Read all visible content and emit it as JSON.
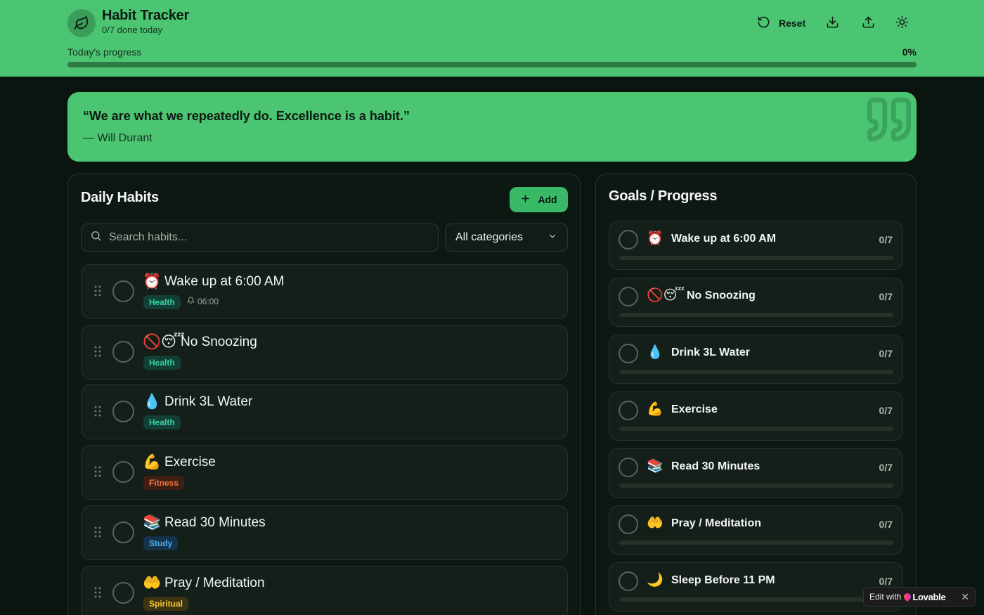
{
  "header": {
    "title": "Habit Tracker",
    "subtitle": "0/7 done today",
    "reset_label": "Reset",
    "progress_label": "Today's progress",
    "progress_pct": "0%",
    "progress_value": 0
  },
  "quote": {
    "text": "“We are what we repeatedly do. Excellence is a habit.”",
    "author": "— Will Durant"
  },
  "daily": {
    "title": "Daily Habits",
    "add_label": "Add",
    "search_placeholder": "Search habits...",
    "category_selected": "All categories",
    "habits": [
      {
        "emoji": "⏰",
        "name": "Wake up at 6:00 AM",
        "tag": "Health",
        "reminder": "06:00"
      },
      {
        "emoji": "🚫😴",
        "name": "No Snoozing",
        "tag": "Health"
      },
      {
        "emoji": "💧",
        "name": "Drink 3L Water",
        "tag": "Health"
      },
      {
        "emoji": "💪",
        "name": "Exercise",
        "tag": "Fitness"
      },
      {
        "emoji": "📚",
        "name": "Read 30 Minutes",
        "tag": "Study"
      },
      {
        "emoji": "🤲",
        "name": "Pray / Meditation",
        "tag": "Spiritual"
      }
    ]
  },
  "goals": {
    "title": "Goals / Progress",
    "items": [
      {
        "emoji": "⏰",
        "name": "Wake up at 6:00 AM",
        "count": "0/7",
        "progress": 0
      },
      {
        "emoji": "🚫😴",
        "name": "No Snoozing",
        "count": "0/7",
        "progress": 0
      },
      {
        "emoji": "💧",
        "name": "Drink 3L Water",
        "count": "0/7",
        "progress": 0
      },
      {
        "emoji": "💪",
        "name": "Exercise",
        "count": "0/7",
        "progress": 0
      },
      {
        "emoji": "📚",
        "name": "Read 30 Minutes",
        "count": "0/7",
        "progress": 0
      },
      {
        "emoji": "🤲",
        "name": "Pray / Meditation",
        "count": "0/7",
        "progress": 0
      },
      {
        "emoji": "🌙",
        "name": "Sleep Before 11 PM",
        "count": "0/7",
        "progress": 0
      }
    ]
  },
  "badge": {
    "prefix": "Edit with",
    "brand": "Lovable"
  },
  "colors": {
    "accent": "#4cc572",
    "button": "#39b865",
    "background": "#0b1510"
  },
  "icons": {
    "logo": "leaf-icon",
    "reset": "rotate-ccw-icon",
    "download": "download-icon",
    "upload": "upload-icon",
    "theme": "sun-icon",
    "search": "search-icon",
    "drag": "grip-vertical-icon",
    "reminder": "bell-icon",
    "quote": "quote-icon"
  }
}
